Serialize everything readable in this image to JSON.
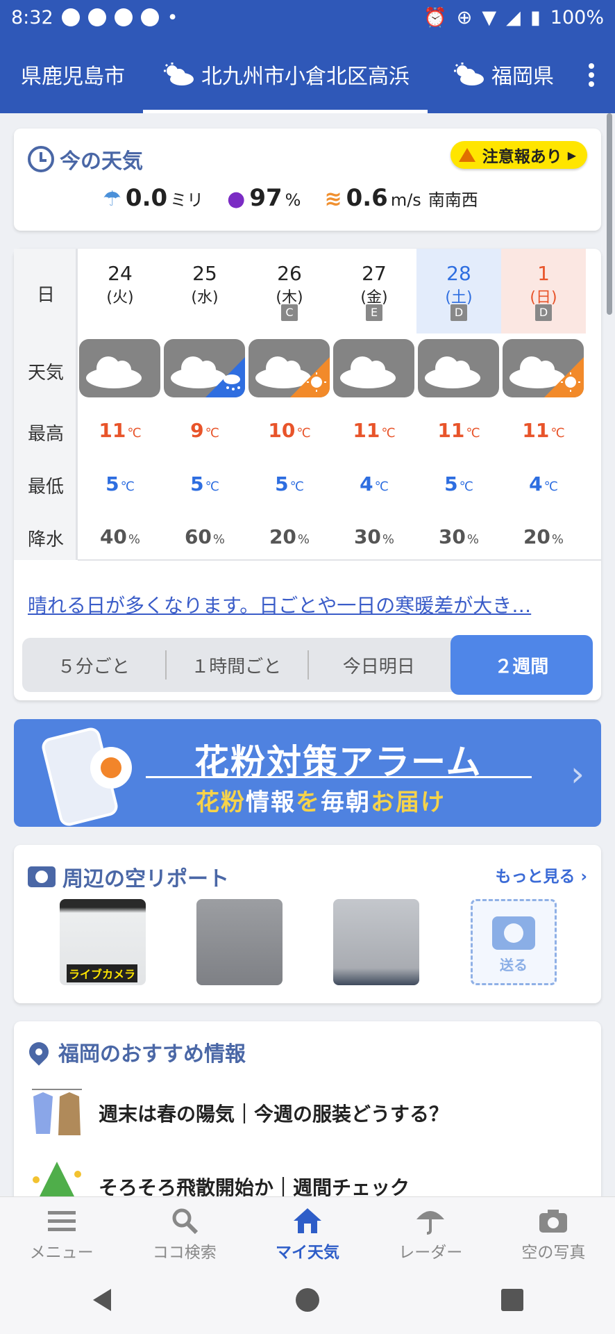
{
  "status": {
    "time": "8:32",
    "battery": "100%"
  },
  "tabs": [
    {
      "label": "県鹿児島市"
    },
    {
      "label": "北九州市小倉北区高浜"
    },
    {
      "label": "福岡県"
    }
  ],
  "now": {
    "title": "今の天気",
    "alert": "注意報あり",
    "precip_value": "0.0",
    "precip_unit": "ミリ",
    "humidity_value": "97",
    "humidity_unit": "%",
    "wind_value": "0.6",
    "wind_unit": "m/s",
    "wind_dir": "南南西"
  },
  "forecast": {
    "labels": {
      "day": "日",
      "weather": "天気",
      "high": "最高",
      "low": "最低",
      "rain": "降水"
    },
    "temp_unit": "℃",
    "rain_unit": "%",
    "days": [
      {
        "date": "24",
        "weekday": "(火)",
        "badge": "",
        "weather": "cloudy",
        "high": "11",
        "low": "5",
        "rain": "40"
      },
      {
        "date": "25",
        "weekday": "(水)",
        "badge": "",
        "weather": "cloudy-rain",
        "high": "9",
        "low": "5",
        "rain": "60"
      },
      {
        "date": "26",
        "weekday": "(木)",
        "badge": "C",
        "weather": "cloudy-sunny",
        "high": "10",
        "low": "5",
        "rain": "20"
      },
      {
        "date": "27",
        "weekday": "(金)",
        "badge": "E",
        "weather": "cloudy",
        "high": "11",
        "low": "4",
        "rain": "30"
      },
      {
        "date": "28",
        "weekday": "(土)",
        "badge": "D",
        "weather": "cloudy",
        "high": "11",
        "low": "5",
        "rain": "30"
      },
      {
        "date": "1",
        "weekday": "(日)",
        "badge": "D",
        "weather": "cloudy-sunny",
        "high": "11",
        "low": "4",
        "rain": "20"
      }
    ],
    "summary_link": "晴れる日が多くなります。日ごとや一日の寒暖差が大き…",
    "segments": [
      "５分ごと",
      "１時間ごと",
      "今日明日",
      "２週間"
    ],
    "active_segment": "２週間"
  },
  "banner": {
    "title": "花粉対策アラーム",
    "sub_1": "花粉",
    "sub_2": "情報",
    "sub_3": "を",
    "sub_4": "毎朝",
    "sub_5": "お届け"
  },
  "sky_report": {
    "title": "周辺の空リポート",
    "more": "もっと見る",
    "live_label": "ライブカメラ",
    "send_label": "送る"
  },
  "recommend": {
    "title": "福岡のおすすめ情報",
    "items": [
      "週末は春の陽気｜今週の服装どうする？",
      "そろそろ飛散開始か｜週間チェック"
    ]
  },
  "bottom_nav": [
    "メニュー",
    "ココ検索",
    "マイ天気",
    "レーダー",
    "空の写真"
  ],
  "colors": {
    "brand": "#2f58b8",
    "high_temp": "#e8542a",
    "low_temp": "#2e6ee0",
    "active_segment": "#4f86e8",
    "alert": "#ffe500"
  }
}
